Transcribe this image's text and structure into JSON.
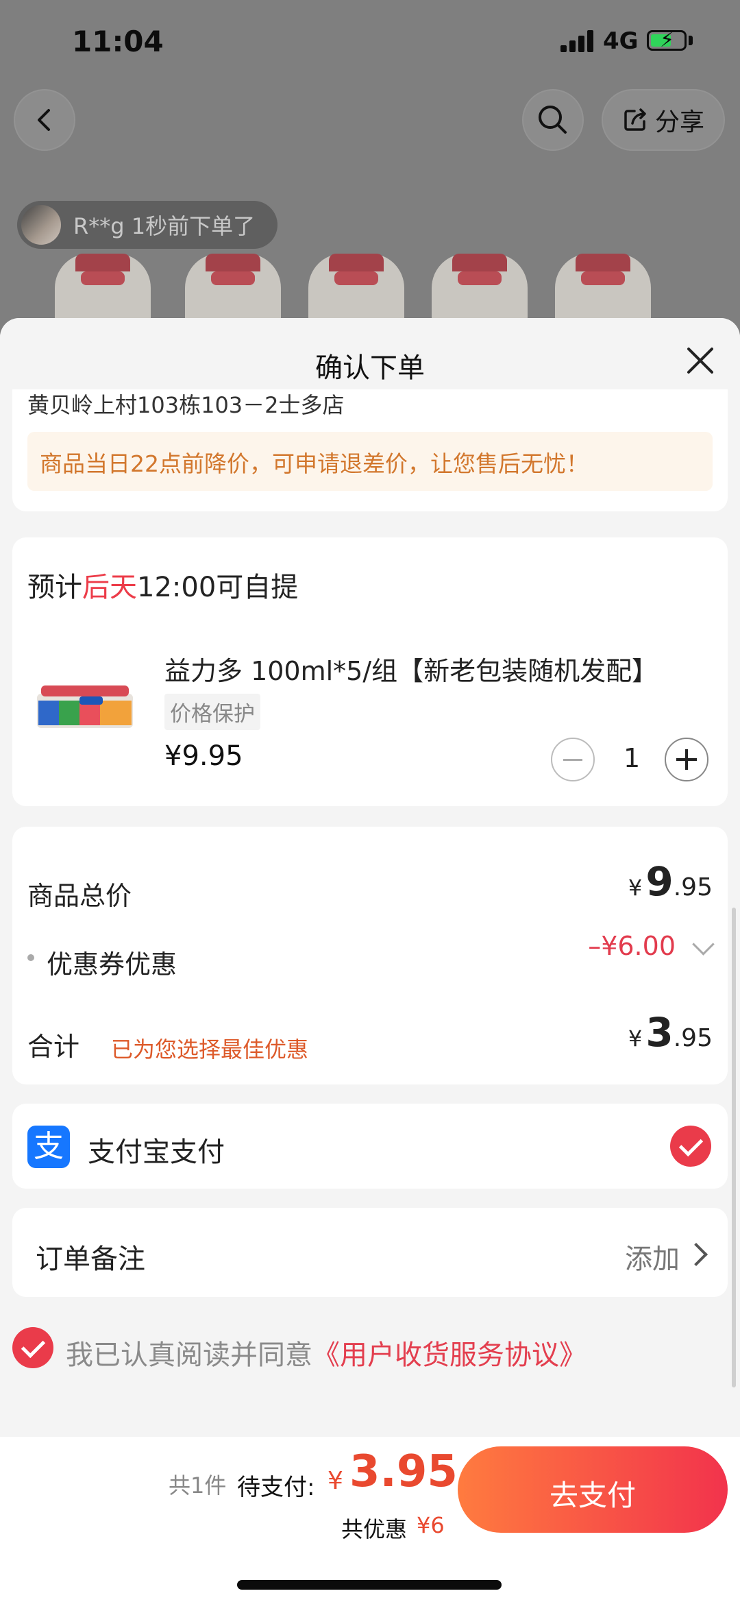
{
  "status_bar": {
    "time": "11:04",
    "network": "4G"
  },
  "bg_page": {
    "share_label": "分享",
    "buyer_notice": "R**g 1秒前下单了"
  },
  "sheet": {
    "title": "确认下单",
    "address": "黄贝岭上村103栋103－2士多店",
    "notice": "商品当日22点前降价，可申请退差价，让您售后无忧！",
    "pickup": {
      "prefix": "预计",
      "highlight": "后天",
      "suffix": "12:00可自提"
    },
    "product": {
      "name": "益力多 100ml*5/组【新老包装随机发配】",
      "tag": "价格保护",
      "price": "¥9.95",
      "quantity": "1"
    },
    "summary": {
      "total_label": "商品总价",
      "total_yen": "¥",
      "total_int": "9",
      "total_dec": ".95",
      "coupon_label": "优惠券优惠",
      "coupon_value": "–¥6.00",
      "sum_label": "合计",
      "sum_note": "已为您选择最佳优惠",
      "sum_yen": "¥",
      "sum_int": "3",
      "sum_dec": ".95"
    },
    "payment": {
      "icon": "支",
      "label": "支付宝支付"
    },
    "remark": {
      "label": "订单备注",
      "action": "添加"
    },
    "agreement": {
      "text": "我已认真阅读并同意",
      "link": "《用户收货服务协议》"
    }
  },
  "footer": {
    "count": "共1件",
    "topay_label": "待支付:",
    "topay_yen": "¥",
    "topay_amount": "3.95",
    "saved_label": "共优惠",
    "saved_amount": "¥6",
    "pay_button": "去支付"
  },
  "colors": {
    "accent": "#ea3b4a",
    "orange": "#e9492f",
    "alipay": "#1677ff"
  }
}
